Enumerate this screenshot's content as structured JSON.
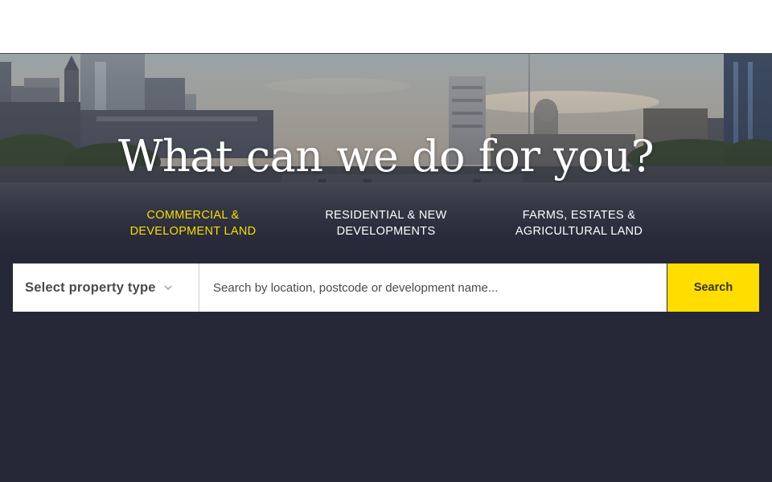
{
  "hero": {
    "headline": "What can we do for you?"
  },
  "categories": [
    {
      "line1": "COMMERCIAL &",
      "line2": "DEVELOPMENT LAND",
      "active": true
    },
    {
      "line1": "RESIDENTIAL & NEW",
      "line2": "DEVELOPMENTS",
      "active": false
    },
    {
      "line1": "FARMS, ESTATES &",
      "line2": "AGRICULTURAL LAND",
      "active": false
    }
  ],
  "search": {
    "property_type_label": "Select property type",
    "placeholder": "Search by location, postcode or development name...",
    "button_label": "Search"
  },
  "colors": {
    "accent": "#ffdd00",
    "background": "#262838",
    "white": "#ffffff"
  },
  "icons": {
    "dropdown": "chevron-down-icon"
  }
}
